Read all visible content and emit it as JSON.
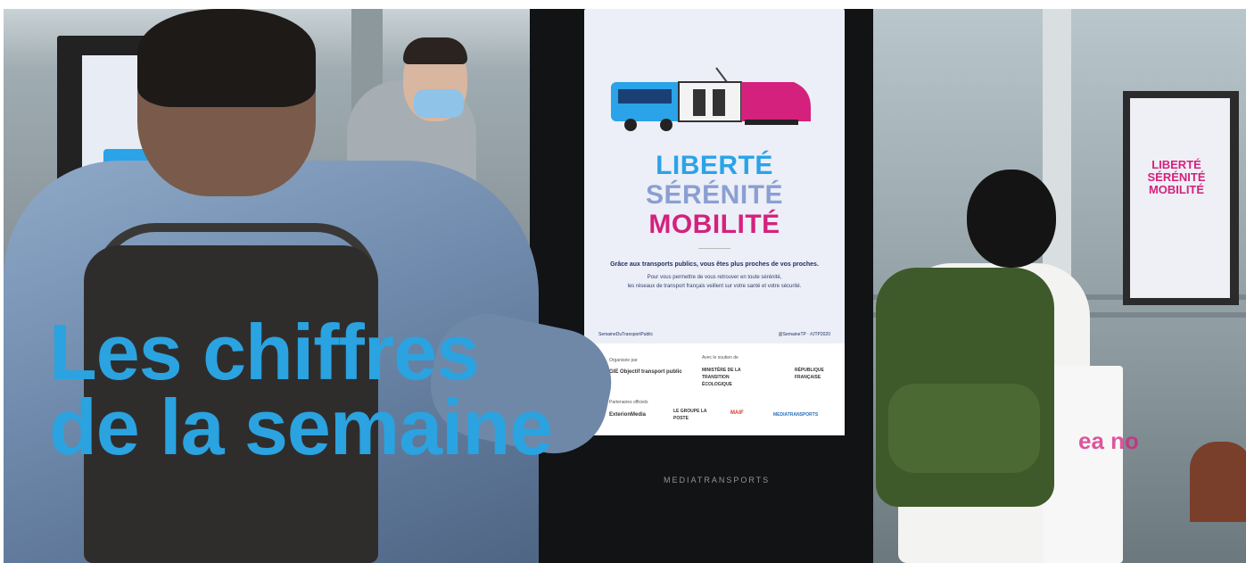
{
  "headline": {
    "line1": "Les chiffres",
    "line2": "de la semaine"
  },
  "poster": {
    "title_line1": "LIBERTÉ",
    "title_line2": "SÉRÉNITÉ",
    "title_line3": "MOBILITÉ",
    "lead": "Grâce aux transports publics, vous êtes plus proches de vos proches.",
    "sub_line1": "Pour vous permettre de vous retrouver en toute sérénité,",
    "sub_line2": "les réseaux de transport français veillent sur votre santé et votre sécurité.",
    "social_left": "SemaineDuTransportPublic",
    "social_right": "@SemaineTP · #JTP2020",
    "organised_label": "Organisée par",
    "supported_label": "Avec le soutien de",
    "partners_label": "Partenaires officiels",
    "logos": [
      "GIE Objectif transport public",
      "MINISTÈRE DE LA TRANSITION ÉCOLOGIQUE",
      "RÉPUBLIQUE FRANÇAISE",
      "ExterionMedia",
      "LE GROUPE LA POSTE",
      "MAIF",
      "MEDIATRANSPORTS"
    ]
  },
  "kiosk_brand": "MEDIATRANSPORTS",
  "right_poster_title": "LIBERTÉ SÉRÉNITÉ MOBILITÉ",
  "tote_text": "ea no",
  "colors": {
    "headline": "#2aa3e0",
    "brand_pink": "#d4217e",
    "brand_blue": "#2aa3e8"
  }
}
